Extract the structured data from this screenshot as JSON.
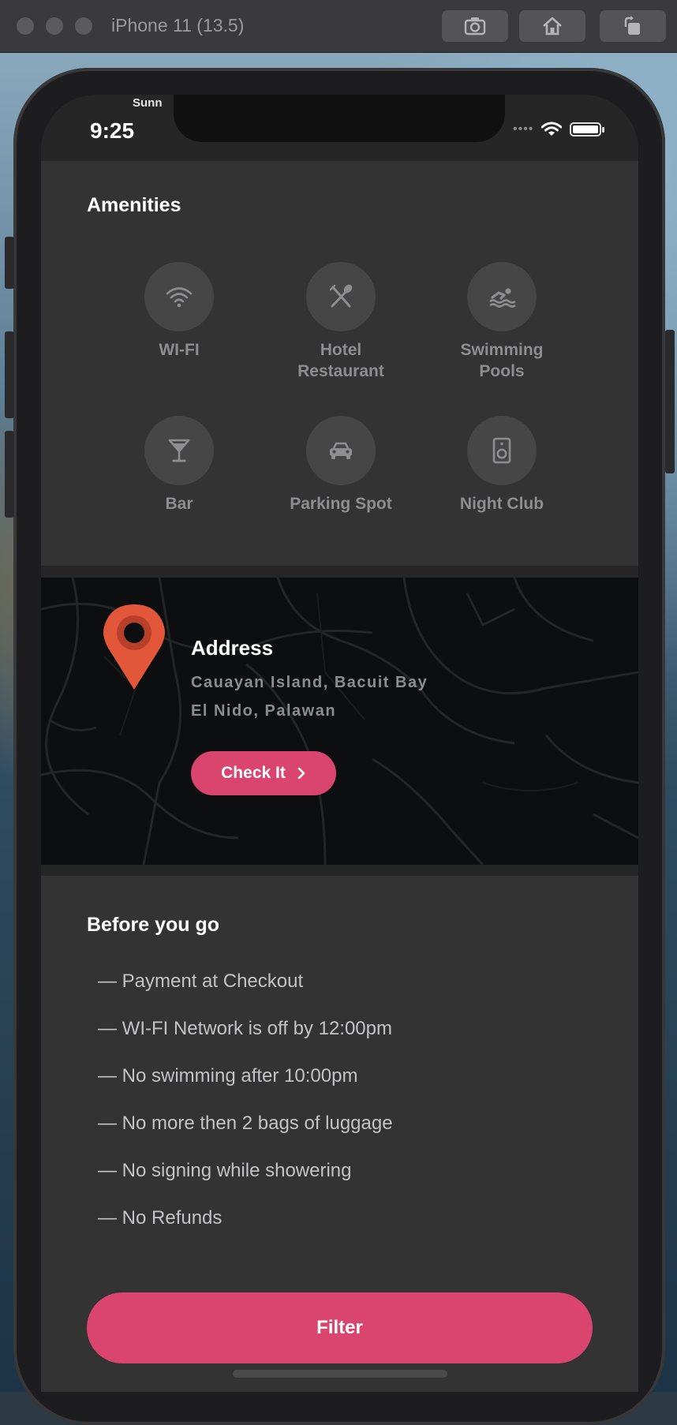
{
  "window": {
    "title": "iPhone 11 (13.5)",
    "buttons": [
      "screenshot",
      "home",
      "rotate"
    ]
  },
  "status_bar": {
    "carrier": "Sunn",
    "time": "9:25",
    "signal": "••••"
  },
  "amenities": {
    "title": "Amenities",
    "items": [
      {
        "label": "WI-FI",
        "icon": "wifi-icon"
      },
      {
        "label": "Hotel\nRestaurant",
        "icon": "fork-knife-icon"
      },
      {
        "label": "Swimming\nPools",
        "icon": "swimmer-icon"
      },
      {
        "label": "Bar",
        "icon": "cocktail-icon"
      },
      {
        "label": "Parking Spot",
        "icon": "car-icon"
      },
      {
        "label": "Night Club",
        "icon": "speaker-icon"
      }
    ]
  },
  "address": {
    "title": "Address",
    "line1": "Cauayan Island, Bacuit Bay",
    "line2": "El Nido, Palawan",
    "button_label": "Check It"
  },
  "before_you_go": {
    "title": "Before you go",
    "rules": [
      "— Payment at Checkout",
      "— WI-FI Network is off by 12:00pm",
      "— No swimming after 10:00pm",
      "— No more then 2 bags of luggage",
      "— No signing while showering",
      "— No Refunds"
    ]
  },
  "filter_button": "Filter",
  "colors": {
    "accent": "#d9456f",
    "pin": "#e2563a",
    "panel": "#333334",
    "map_bg": "#0d0e10"
  }
}
